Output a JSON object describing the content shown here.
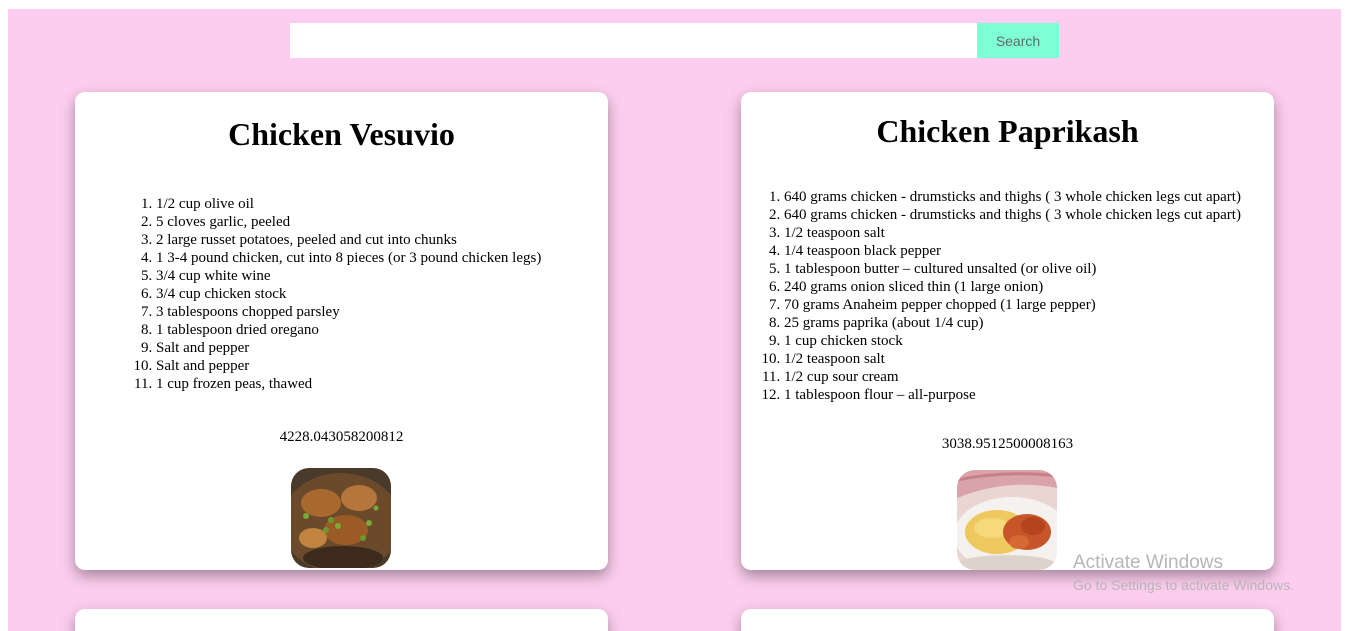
{
  "search": {
    "placeholder": "",
    "value": "",
    "button_label": "Search"
  },
  "recipes": [
    {
      "title": "Chicken Vesuvio",
      "ingredients": [
        "1/2 cup olive oil",
        "5 cloves garlic, peeled",
        "2 large russet potatoes, peeled and cut into chunks",
        "1 3-4 pound chicken, cut into 8 pieces (or 3 pound chicken legs)",
        "3/4 cup white wine",
        "3/4 cup chicken stock",
        "3 tablespoons chopped parsley",
        "1 tablespoon dried oregano",
        "Salt and pepper",
        "Salt and pepper",
        "1 cup frozen peas, thawed"
      ],
      "calories": "4228.043058200812"
    },
    {
      "title": "Chicken Paprikash",
      "ingredients": [
        "640 grams chicken - drumsticks and thighs ( 3 whole chicken legs cut apart)",
        "640 grams chicken - drumsticks and thighs ( 3 whole chicken legs cut apart)",
        "1/2 teaspoon salt",
        "1/4 teaspoon black pepper",
        "1 tablespoon butter – cultured unsalted (or olive oil)",
        "240 grams onion sliced thin (1 large onion)",
        "70 grams Anaheim pepper chopped (1 large pepper)",
        "25 grams paprika (about 1/4 cup)",
        "1 cup chicken stock",
        "1/2 teaspoon salt",
        "1/2 cup sour cream",
        "1 tablespoon flour – all-purpose"
      ],
      "calories": "3038.9512500008163"
    }
  ],
  "watermark": {
    "title": "Activate Windows",
    "subtitle": "Go to Settings to activate Windows."
  },
  "colors": {
    "background": "#fccdee",
    "search_button": "#7fffd4",
    "card": "#ffffff"
  }
}
